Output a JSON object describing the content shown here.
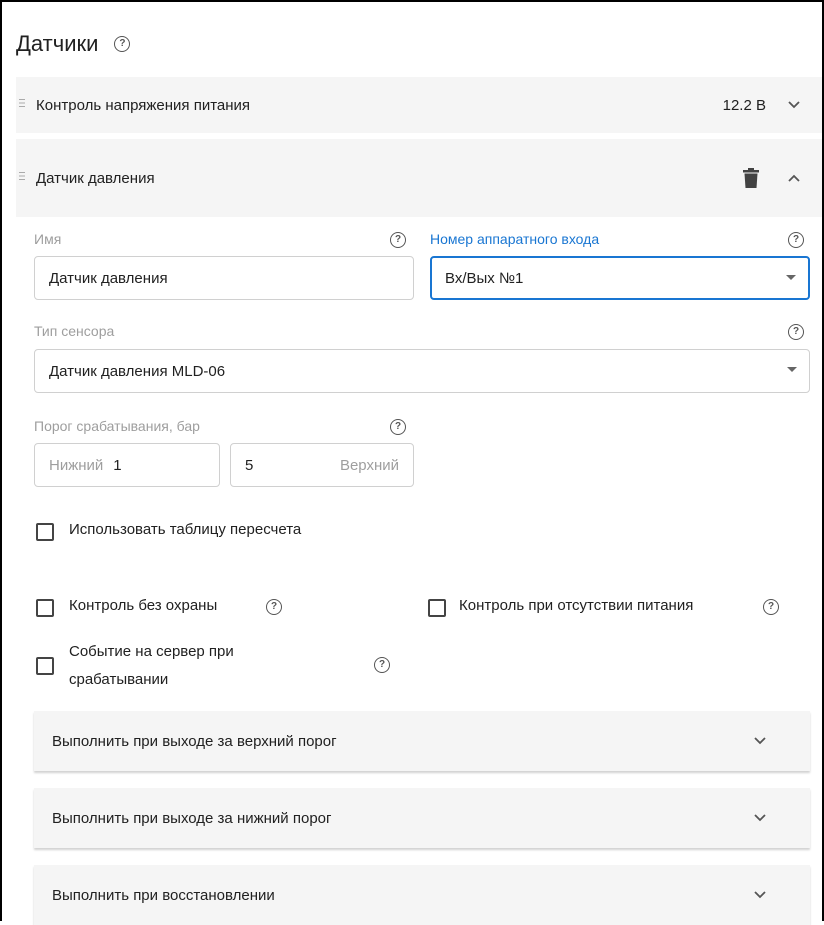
{
  "header": {
    "title": "Датчики"
  },
  "panels": {
    "voltage": {
      "title": "Контроль напряжения питания",
      "value": "12.2 В"
    },
    "pressure": {
      "title": "Датчик давления"
    }
  },
  "form": {
    "name": {
      "label": "Имя",
      "value": "Датчик давления"
    },
    "hw_input": {
      "label": "Номер аппаратного входа",
      "value": "Вх/Вых №1"
    },
    "sensor_type": {
      "label": "Тип сенсора",
      "value": "Датчик давления MLD-06"
    },
    "threshold": {
      "label": "Порог срабатывания, бар",
      "lower_label": "Нижний",
      "lower_value": "1",
      "upper_label": "Верхний",
      "upper_value": "5"
    },
    "use_table": "Использовать таблицу пересчета",
    "no_guard": "Контроль без охраны",
    "no_power": "Контроль при отсутствии питания",
    "server_event_line1": "Событие на сервер при",
    "server_event_line2": "срабатывании"
  },
  "actions": {
    "upper": "Выполнить при выходе за верхний порог",
    "lower": "Выполнить при выходе за нижний порог",
    "restore": "Выполнить при восстановлении"
  },
  "icons": {
    "help": "help-circle-icon",
    "drag": "drag-handle-icon",
    "delete": "trash-icon",
    "expand": "chevron-down-icon",
    "collapse": "chevron-up-icon"
  },
  "colors": {
    "accent": "#1976d2",
    "panel": "#f5f5f5"
  },
  "help_glyph": "?"
}
